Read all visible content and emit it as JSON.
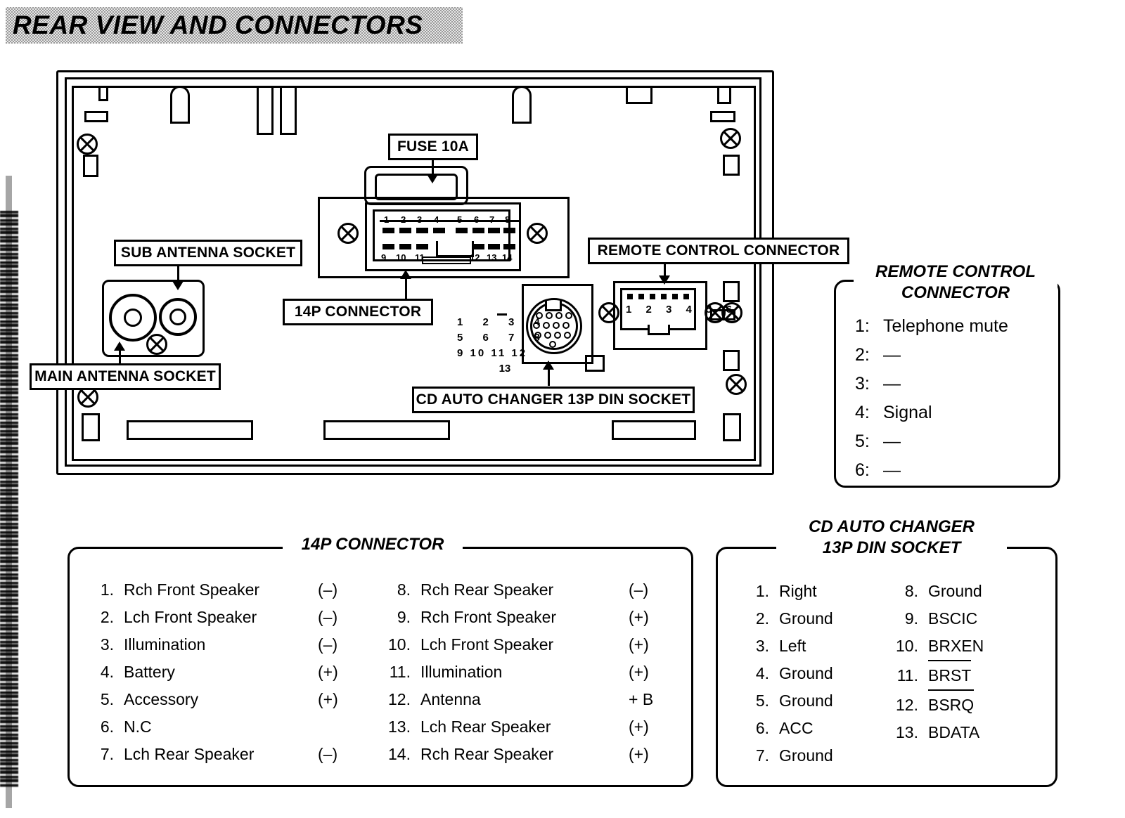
{
  "page": {
    "title": "REAR VIEW AND CONNECTORS"
  },
  "diagram": {
    "callouts": {
      "fuse": "FUSE 10A",
      "sub_antenna": "SUB ANTENNA SOCKET",
      "main_antenna": "MAIN ANTENNA SOCKET",
      "connector_14p": "14P CONNECTOR",
      "remote_control": "REMOTE CONTROL CONNECTOR",
      "cd_changer": "CD AUTO CHANGER 13P DIN SOCKET"
    },
    "connector_14p_pins_top": [
      "1",
      "2",
      "3",
      "4",
      "5",
      "6",
      "7",
      "8"
    ],
    "connector_14p_pins_bottom_left": [
      "9",
      "10",
      "11"
    ],
    "connector_14p_pins_bottom_right": [
      "12",
      "13",
      "14"
    ],
    "din_pin_grid": [
      [
        "1",
        "2",
        "3",
        "4"
      ],
      [
        "5",
        "6",
        "7",
        "8"
      ],
      [
        "9",
        "10",
        "11",
        "12"
      ],
      [
        "13"
      ]
    ],
    "remote_pin_numbers": [
      "1",
      "2",
      "3",
      "4",
      "5",
      "6"
    ]
  },
  "remote_panel": {
    "title_line1": "REMOTE CONTROL",
    "title_line2": "CONNECTOR",
    "rows": [
      {
        "num": "1:",
        "value": "Telephone mute"
      },
      {
        "num": "2:",
        "value": "—"
      },
      {
        "num": "3:",
        "value": "—"
      },
      {
        "num": "4:",
        "value": "Signal"
      },
      {
        "num": "5:",
        "value": "—"
      },
      {
        "num": "6:",
        "value": "—"
      }
    ]
  },
  "panel_14p": {
    "title": "14P CONNECTOR",
    "left_column": [
      {
        "num": "1.",
        "name": "Rch Front Speaker",
        "sign": "(–)"
      },
      {
        "num": "2.",
        "name": "Lch Front Speaker",
        "sign": "(–)"
      },
      {
        "num": "3.",
        "name": "Illumination",
        "sign": "(–)"
      },
      {
        "num": "4.",
        "name": "Battery",
        "sign": "(+)"
      },
      {
        "num": "5.",
        "name": "Accessory",
        "sign": "(+)"
      },
      {
        "num": "6.",
        "name": "N.C",
        "sign": ""
      },
      {
        "num": "7.",
        "name": "Lch Rear Speaker",
        "sign": "(–)"
      }
    ],
    "right_column": [
      {
        "num": "8.",
        "name": "Rch Rear Speaker",
        "sign": "(–)"
      },
      {
        "num": "9.",
        "name": "Rch Front Speaker",
        "sign": "(+)"
      },
      {
        "num": "10.",
        "name": "Lch Front Speaker",
        "sign": "(+)"
      },
      {
        "num": "11.",
        "name": "Illumination",
        "sign": "(+)"
      },
      {
        "num": "12.",
        "name": "Antenna",
        "sign": "+ B"
      },
      {
        "num": "13.",
        "name": "Lch Rear Speaker",
        "sign": "(+)"
      },
      {
        "num": "14.",
        "name": "Rch Rear Speaker",
        "sign": "(+)"
      }
    ]
  },
  "panel_cd": {
    "title_line1": "CD AUTO CHANGER",
    "title_line2": "13P DIN SOCKET",
    "left_column": [
      {
        "num": "1.",
        "name": "Right",
        "overline": false
      },
      {
        "num": "2.",
        "name": "Ground",
        "overline": false
      },
      {
        "num": "3.",
        "name": "Left",
        "overline": false
      },
      {
        "num": "4.",
        "name": "Ground",
        "overline": false
      },
      {
        "num": "5.",
        "name": "Ground",
        "overline": false
      },
      {
        "num": "6.",
        "name": "ACC",
        "overline": false
      },
      {
        "num": "7.",
        "name": "Ground",
        "overline": false
      }
    ],
    "right_column": [
      {
        "num": "8.",
        "name": "Ground",
        "overline": false
      },
      {
        "num": "9.",
        "name": "BSCIC",
        "overline": false
      },
      {
        "num": "10.",
        "name": "BRXEN",
        "overline": false
      },
      {
        "num": "11.",
        "name": "BRST",
        "overline": true
      },
      {
        "num": "12.",
        "name": "BSRQ",
        "overline": true
      },
      {
        "num": "13.",
        "name": "BDATA",
        "overline": false
      }
    ]
  },
  "colors": {
    "ink": "#000000",
    "paper": "#ffffff",
    "header_band": "#c9c9c9"
  }
}
